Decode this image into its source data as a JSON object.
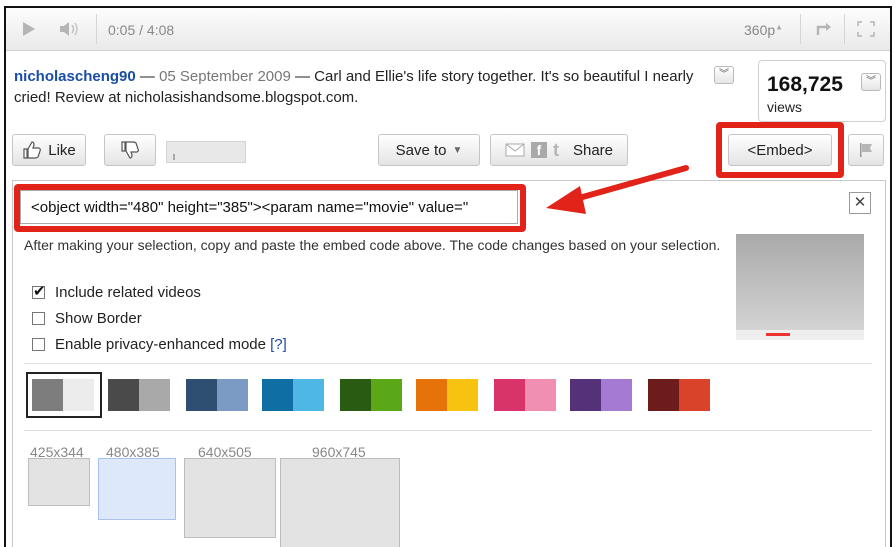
{
  "player": {
    "time": "0:05 / 4:08",
    "quality": "360p",
    "icons": [
      "play-icon",
      "volume-icon",
      "popout-icon",
      "fullscreen-icon"
    ]
  },
  "description": {
    "uploader": "nicholascheng90",
    "dash1": " — ",
    "date": "05 September 2009",
    "dash2": " — ",
    "text": "Carl and Ellie's life story together. It's so beautiful I nearly cried! Review at nicholasishandsome.blogspot.com."
  },
  "views": {
    "count": "168,725",
    "label": "views"
  },
  "actions": {
    "like": "Like",
    "save_to": "Save to",
    "share": "Share",
    "embed": "<Embed>"
  },
  "embed_panel": {
    "code": "<object width=\"480\" height=\"385\"><param name=\"movie\" value=\"",
    "close": "✕",
    "instructions": "After making your selection, copy and paste the embed code above. The code changes based on your selection.",
    "options": [
      {
        "label": "Include related videos",
        "checked": true
      },
      {
        "label": "Show Border",
        "checked": false
      },
      {
        "label": "Enable privacy-enhanced mode",
        "checked": false,
        "help": "[?]"
      }
    ],
    "sizes": [
      "425x344",
      "480x385",
      "640x505",
      "960x745"
    ]
  },
  "colors": {
    "highlight_red": "#e2231a",
    "link_blue": "#1a4ea6",
    "swatches": [
      [
        "#7d7d7d",
        "#ececec"
      ],
      [
        "#4a4a4a",
        "#a9a9a9"
      ],
      [
        "#2f4f72",
        "#7b9bc4"
      ],
      [
        "#0f6fa5",
        "#4fb7e3"
      ],
      [
        "#2a5b12",
        "#5aa717"
      ],
      [
        "#e6730a",
        "#f7c310"
      ],
      [
        "#d8346a",
        "#f08fb1"
      ],
      [
        "#55317a",
        "#a47ad2"
      ],
      [
        "#6d1c1c",
        "#d8432a"
      ]
    ]
  }
}
